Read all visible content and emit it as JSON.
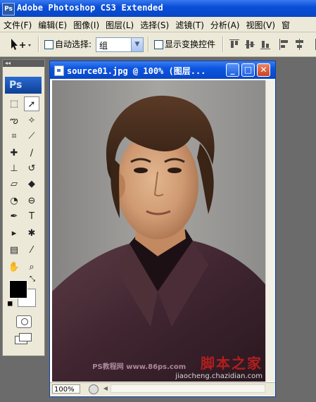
{
  "app": {
    "title": "Adobe Photoshop CS3 Extended",
    "badge": "Ps"
  },
  "menu": [
    "文件(F)",
    "编辑(E)",
    "图像(I)",
    "图层(L)",
    "选择(S)",
    "滤镜(T)",
    "分析(A)",
    "视图(V)",
    "窗"
  ],
  "options": {
    "auto_select_label": "自动选择:",
    "auto_select_value": "组",
    "show_transform_label": "显示变换控件",
    "auto_select_checked": false,
    "show_transform_checked": false
  },
  "toolbox": {
    "collapse_glyph": "◂◂",
    "logo": "Ps",
    "tools": [
      {
        "icon": "marquee-icon",
        "glyph": "⬚"
      },
      {
        "icon": "move-icon",
        "glyph": "➚"
      },
      {
        "icon": "lasso-icon",
        "glyph": "ఌ"
      },
      {
        "icon": "magic-wand-icon",
        "glyph": "✧"
      },
      {
        "icon": "crop-icon",
        "glyph": "⌗"
      },
      {
        "icon": "slice-icon",
        "glyph": "⟋"
      },
      {
        "icon": "healing-brush-icon",
        "glyph": "✚"
      },
      {
        "icon": "brush-icon",
        "glyph": "∕"
      },
      {
        "icon": "clone-stamp-icon",
        "glyph": "⊥"
      },
      {
        "icon": "history-brush-icon",
        "glyph": "↺"
      },
      {
        "icon": "eraser-icon",
        "glyph": "▱"
      },
      {
        "icon": "paint-bucket-icon",
        "glyph": "◆"
      },
      {
        "icon": "blur-icon",
        "glyph": "◔"
      },
      {
        "icon": "dodge-icon",
        "glyph": "⊖"
      },
      {
        "icon": "pen-icon",
        "glyph": "✒"
      },
      {
        "icon": "type-icon",
        "glyph": "T"
      },
      {
        "icon": "path-select-icon",
        "glyph": "▸"
      },
      {
        "icon": "shape-icon",
        "glyph": "✱"
      },
      {
        "icon": "notes-icon",
        "glyph": "▤"
      },
      {
        "icon": "eyedropper-icon",
        "glyph": "⁄"
      },
      {
        "icon": "hand-icon",
        "glyph": "✋"
      },
      {
        "icon": "zoom-icon",
        "glyph": "⌕"
      }
    ],
    "active_tool": "move-icon",
    "foreground_color": "#000000",
    "background_color": "#ffffff"
  },
  "document": {
    "title": "source01.jpg @ 100% (图层...",
    "zoom": "100%",
    "buttons": {
      "minimize": "_",
      "maximize": "□",
      "close": "✕"
    }
  },
  "watermark": {
    "site_big": "脚本之家",
    "site_url": "jiaocheng.chazidian.com",
    "overlay": "PS教程网 www.86ps.com"
  },
  "colors": {
    "titlebar": "#0a4fd8",
    "chrome": "#ece9d8",
    "workspace": "#6b6b6b",
    "close_button": "#c8431f"
  }
}
